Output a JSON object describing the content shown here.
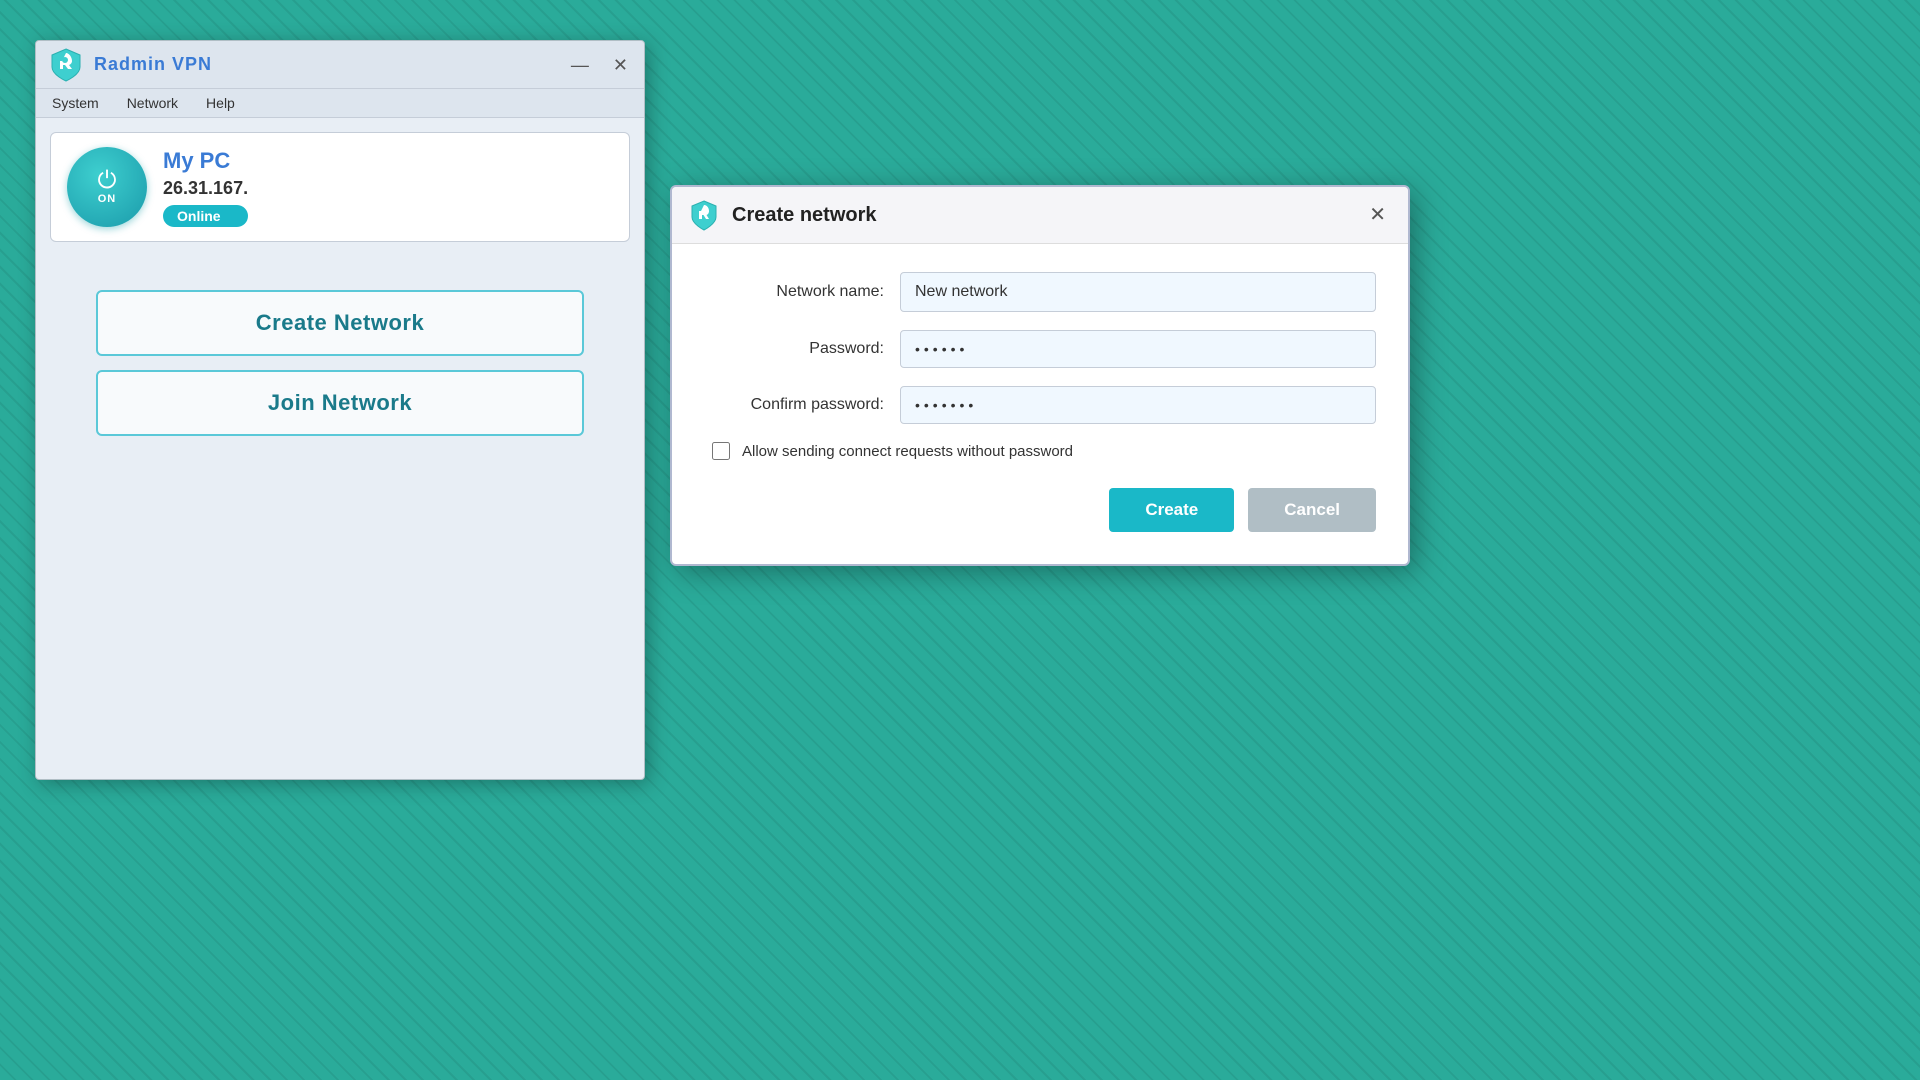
{
  "app": {
    "title_radmin": "Radmin",
    "title_vpn": "VPN",
    "minimize_btn": "—",
    "close_btn": "✕"
  },
  "menu": {
    "items": [
      "System",
      "Network",
      "Help"
    ]
  },
  "pc_card": {
    "name": "My PC",
    "ip": "26.31.167.",
    "status": "Online",
    "power_label": "ON"
  },
  "buttons": {
    "create_network": "Create Network",
    "join_network": "Join Network"
  },
  "dialog": {
    "title": "Create network",
    "close_btn": "✕",
    "network_name_label": "Network name:",
    "network_name_value": "New network",
    "password_label": "Password:",
    "password_value": "●●●●●●",
    "confirm_password_label": "Confirm password:",
    "confirm_password_value": "●●●●●●●",
    "checkbox_label": "Allow sending connect requests without password",
    "create_btn": "Create",
    "cancel_btn": "Cancel"
  }
}
